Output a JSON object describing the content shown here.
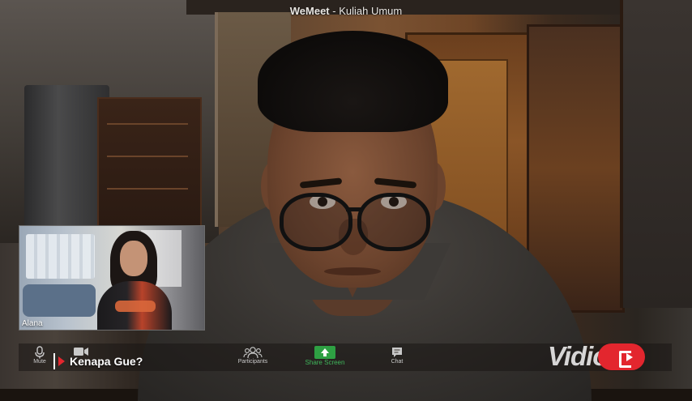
{
  "window": {
    "app_name": "WeMeet",
    "separator": " - ",
    "meeting_name": "Kuliah Umum"
  },
  "self_view": {
    "participant_name": "Alana"
  },
  "toolbar": {
    "mute_label": "Mute",
    "video_label": "",
    "participants_label": "Participants",
    "share_label": "Share Screen",
    "chat_label": "Chat"
  },
  "overlay": {
    "episode_title": "Kenapa Gue?"
  },
  "watermark": {
    "brand": "Vidio"
  },
  "colors": {
    "share_accent": "#2ea043",
    "brand_red": "#e3262e"
  }
}
